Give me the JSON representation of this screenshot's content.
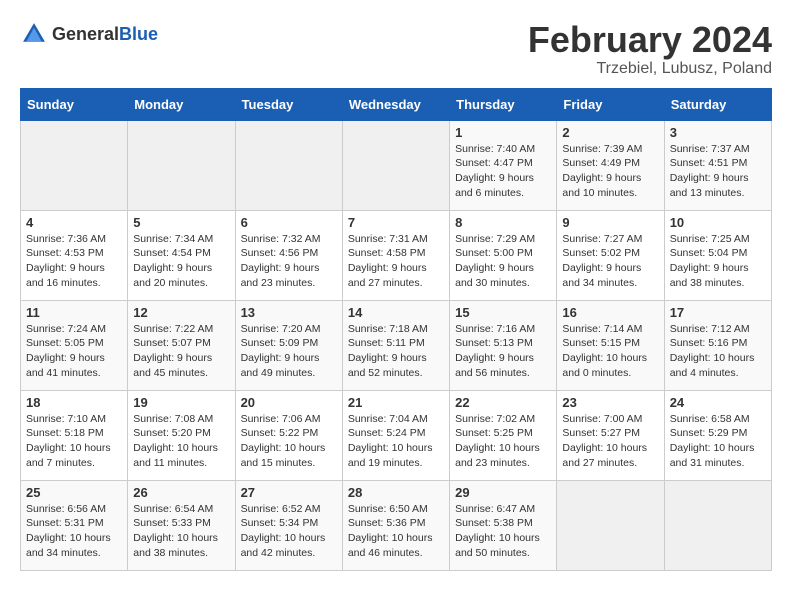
{
  "header": {
    "logo_general": "General",
    "logo_blue": "Blue",
    "title": "February 2024",
    "subtitle": "Trzebiel, Lubusz, Poland"
  },
  "days_of_week": [
    "Sunday",
    "Monday",
    "Tuesday",
    "Wednesday",
    "Thursday",
    "Friday",
    "Saturday"
  ],
  "weeks": [
    [
      {
        "day": "",
        "info": ""
      },
      {
        "day": "",
        "info": ""
      },
      {
        "day": "",
        "info": ""
      },
      {
        "day": "",
        "info": ""
      },
      {
        "day": "1",
        "info": "Sunrise: 7:40 AM\nSunset: 4:47 PM\nDaylight: 9 hours\nand 6 minutes."
      },
      {
        "day": "2",
        "info": "Sunrise: 7:39 AM\nSunset: 4:49 PM\nDaylight: 9 hours\nand 10 minutes."
      },
      {
        "day": "3",
        "info": "Sunrise: 7:37 AM\nSunset: 4:51 PM\nDaylight: 9 hours\nand 13 minutes."
      }
    ],
    [
      {
        "day": "4",
        "info": "Sunrise: 7:36 AM\nSunset: 4:53 PM\nDaylight: 9 hours\nand 16 minutes."
      },
      {
        "day": "5",
        "info": "Sunrise: 7:34 AM\nSunset: 4:54 PM\nDaylight: 9 hours\nand 20 minutes."
      },
      {
        "day": "6",
        "info": "Sunrise: 7:32 AM\nSunset: 4:56 PM\nDaylight: 9 hours\nand 23 minutes."
      },
      {
        "day": "7",
        "info": "Sunrise: 7:31 AM\nSunset: 4:58 PM\nDaylight: 9 hours\nand 27 minutes."
      },
      {
        "day": "8",
        "info": "Sunrise: 7:29 AM\nSunset: 5:00 PM\nDaylight: 9 hours\nand 30 minutes."
      },
      {
        "day": "9",
        "info": "Sunrise: 7:27 AM\nSunset: 5:02 PM\nDaylight: 9 hours\nand 34 minutes."
      },
      {
        "day": "10",
        "info": "Sunrise: 7:25 AM\nSunset: 5:04 PM\nDaylight: 9 hours\nand 38 minutes."
      }
    ],
    [
      {
        "day": "11",
        "info": "Sunrise: 7:24 AM\nSunset: 5:05 PM\nDaylight: 9 hours\nand 41 minutes."
      },
      {
        "day": "12",
        "info": "Sunrise: 7:22 AM\nSunset: 5:07 PM\nDaylight: 9 hours\nand 45 minutes."
      },
      {
        "day": "13",
        "info": "Sunrise: 7:20 AM\nSunset: 5:09 PM\nDaylight: 9 hours\nand 49 minutes."
      },
      {
        "day": "14",
        "info": "Sunrise: 7:18 AM\nSunset: 5:11 PM\nDaylight: 9 hours\nand 52 minutes."
      },
      {
        "day": "15",
        "info": "Sunrise: 7:16 AM\nSunset: 5:13 PM\nDaylight: 9 hours\nand 56 minutes."
      },
      {
        "day": "16",
        "info": "Sunrise: 7:14 AM\nSunset: 5:15 PM\nDaylight: 10 hours\nand 0 minutes."
      },
      {
        "day": "17",
        "info": "Sunrise: 7:12 AM\nSunset: 5:16 PM\nDaylight: 10 hours\nand 4 minutes."
      }
    ],
    [
      {
        "day": "18",
        "info": "Sunrise: 7:10 AM\nSunset: 5:18 PM\nDaylight: 10 hours\nand 7 minutes."
      },
      {
        "day": "19",
        "info": "Sunrise: 7:08 AM\nSunset: 5:20 PM\nDaylight: 10 hours\nand 11 minutes."
      },
      {
        "day": "20",
        "info": "Sunrise: 7:06 AM\nSunset: 5:22 PM\nDaylight: 10 hours\nand 15 minutes."
      },
      {
        "day": "21",
        "info": "Sunrise: 7:04 AM\nSunset: 5:24 PM\nDaylight: 10 hours\nand 19 minutes."
      },
      {
        "day": "22",
        "info": "Sunrise: 7:02 AM\nSunset: 5:25 PM\nDaylight: 10 hours\nand 23 minutes."
      },
      {
        "day": "23",
        "info": "Sunrise: 7:00 AM\nSunset: 5:27 PM\nDaylight: 10 hours\nand 27 minutes."
      },
      {
        "day": "24",
        "info": "Sunrise: 6:58 AM\nSunset: 5:29 PM\nDaylight: 10 hours\nand 31 minutes."
      }
    ],
    [
      {
        "day": "25",
        "info": "Sunrise: 6:56 AM\nSunset: 5:31 PM\nDaylight: 10 hours\nand 34 minutes."
      },
      {
        "day": "26",
        "info": "Sunrise: 6:54 AM\nSunset: 5:33 PM\nDaylight: 10 hours\nand 38 minutes."
      },
      {
        "day": "27",
        "info": "Sunrise: 6:52 AM\nSunset: 5:34 PM\nDaylight: 10 hours\nand 42 minutes."
      },
      {
        "day": "28",
        "info": "Sunrise: 6:50 AM\nSunset: 5:36 PM\nDaylight: 10 hours\nand 46 minutes."
      },
      {
        "day": "29",
        "info": "Sunrise: 6:47 AM\nSunset: 5:38 PM\nDaylight: 10 hours\nand 50 minutes."
      },
      {
        "day": "",
        "info": ""
      },
      {
        "day": "",
        "info": ""
      }
    ]
  ]
}
